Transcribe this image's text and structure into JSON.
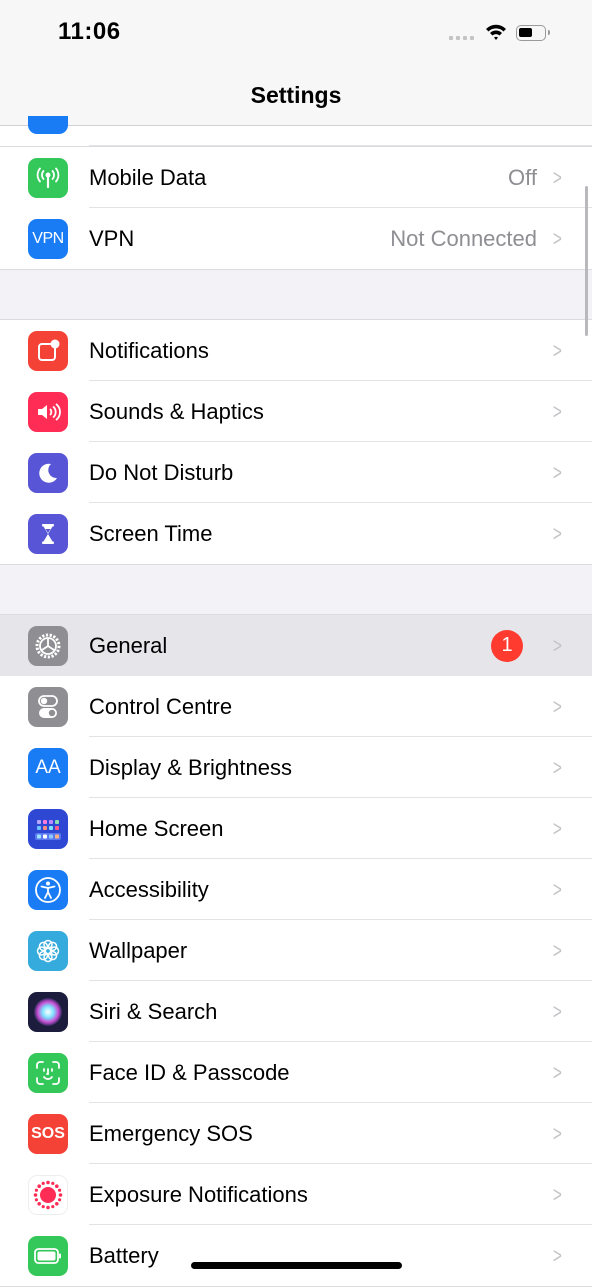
{
  "status_bar": {
    "time": "11:06",
    "battery_level": 0.5
  },
  "nav": {
    "title": "Settings"
  },
  "groups": [
    {
      "rows": [
        {
          "label": "Mobile Data",
          "value": "Off",
          "icon": "antenna-icon",
          "color": "#34c759"
        },
        {
          "label": "VPN",
          "value": "Not Connected",
          "icon": "vpn-icon",
          "color": "#1a7cf5",
          "icon_text": "VPN"
        }
      ]
    },
    {
      "rows": [
        {
          "label": "Notifications",
          "icon": "notifications-icon",
          "color": "#f44336"
        },
        {
          "label": "Sounds & Haptics",
          "icon": "speaker-icon",
          "color": "#ff2d55"
        },
        {
          "label": "Do Not Disturb",
          "icon": "moon-icon",
          "color": "#5856d6"
        },
        {
          "label": "Screen Time",
          "icon": "hourglass-icon",
          "color": "#5856d6"
        }
      ]
    },
    {
      "rows": [
        {
          "label": "General",
          "badge": "1",
          "icon": "gear-icon",
          "color": "#8e8e93"
        },
        {
          "label": "Control Centre",
          "icon": "toggles-icon",
          "color": "#8e8e93"
        },
        {
          "label": "Display & Brightness",
          "icon": "text-size-icon",
          "color": "#1a7cf5",
          "icon_text": "AA"
        },
        {
          "label": "Home Screen",
          "icon": "app-grid-icon",
          "color": "#2f48d4"
        },
        {
          "label": "Accessibility",
          "icon": "accessibility-icon",
          "color": "#1a7cf5"
        },
        {
          "label": "Wallpaper",
          "icon": "flower-icon",
          "color": "#35aadc"
        },
        {
          "label": "Siri & Search",
          "icon": "siri-icon",
          "color": "#1c1c3c"
        },
        {
          "label": "Face ID & Passcode",
          "icon": "face-id-icon",
          "color": "#34c759"
        },
        {
          "label": "Emergency SOS",
          "icon": "sos-icon",
          "color": "#f44336",
          "icon_text": "SOS"
        },
        {
          "label": "Exposure Notifications",
          "icon": "exposure-icon",
          "color": "#ffffff"
        },
        {
          "label": "Battery",
          "icon": "battery-icon",
          "color": "#34c759"
        }
      ]
    }
  ]
}
